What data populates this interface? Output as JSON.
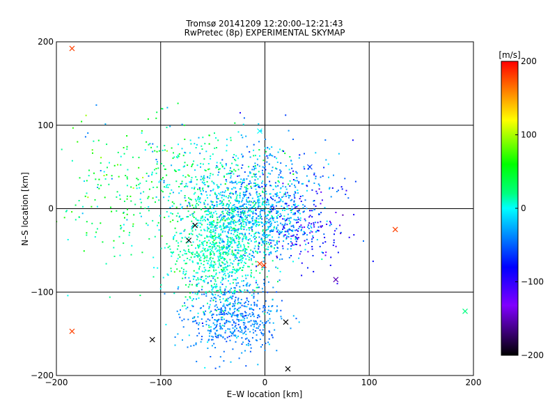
{
  "chart_data": {
    "type": "scatter",
    "title": "Tromsø 20141209 12:20:00–12:21:43",
    "subtitle": "RwPretec (8p) EXPERIMENTAL SKYMAP",
    "xlabel": "E–W location [km]",
    "ylabel": "N–S location [km]",
    "xlim": [
      -200,
      200
    ],
    "ylim": [
      -200,
      200
    ],
    "xticks": [
      -200,
      -100,
      0,
      100,
      200
    ],
    "yticks": [
      -200,
      -100,
      0,
      100,
      200
    ],
    "grid": true,
    "colorbar": {
      "label": "[m/s]",
      "range": [
        -200,
        200
      ],
      "ticks": [
        200,
        100,
        0,
        -100,
        -200
      ],
      "colors": [
        "#000000",
        "#8000ff",
        "#0000ff",
        "#00ffff",
        "#00ff00",
        "#ffff00",
        "#ff0000"
      ]
    },
    "small_points_note": "dense cloud of small marks, approximate clusters",
    "clusters": [
      {
        "cx": -45,
        "cy": -50,
        "sx": 22,
        "sy": 35,
        "n": 900,
        "v": 10,
        "vs": 14
      },
      {
        "cx": -30,
        "cy": -130,
        "sx": 22,
        "sy": 22,
        "n": 500,
        "v": -40,
        "vs": 12
      },
      {
        "cx": -5,
        "cy": -15,
        "sx": 25,
        "sy": 22,
        "n": 600,
        "v": -25,
        "vs": 20
      },
      {
        "cx": 40,
        "cy": -20,
        "sx": 20,
        "sy": 25,
        "n": 160,
        "v": -90,
        "vs": 25
      },
      {
        "cx": -130,
        "cy": 20,
        "sx": 45,
        "sy": 45,
        "n": 260,
        "v": 30,
        "vs": 30
      },
      {
        "cx": -50,
        "cy": 30,
        "sx": 35,
        "sy": 30,
        "n": 350,
        "v": 10,
        "vs": 25
      },
      {
        "cx": 10,
        "cy": 30,
        "sx": 30,
        "sy": 30,
        "n": 250,
        "v": -40,
        "vs": 25
      }
    ],
    "crosses": [
      {
        "x": -185,
        "y": 192,
        "v": 180
      },
      {
        "x": -185,
        "y": -147,
        "v": 180
      },
      {
        "x": -108,
        "y": -157,
        "v": -200
      },
      {
        "x": -73,
        "y": -38,
        "v": -200
      },
      {
        "x": -67,
        "y": -20,
        "v": -200
      },
      {
        "x": -5,
        "y": -66,
        "v": 180
      },
      {
        "x": -1,
        "y": -68,
        "v": 180
      },
      {
        "x": 20,
        "y": -136,
        "v": -200
      },
      {
        "x": 22,
        "y": -192,
        "v": -200
      },
      {
        "x": -5,
        "y": 93,
        "v": 0
      },
      {
        "x": 192,
        "y": -123,
        "v": 20
      },
      {
        "x": 43,
        "y": 50,
        "v": -60
      },
      {
        "x": 125,
        "y": -25,
        "v": 180
      },
      {
        "x": 68,
        "y": -85,
        "v": -150
      }
    ]
  }
}
